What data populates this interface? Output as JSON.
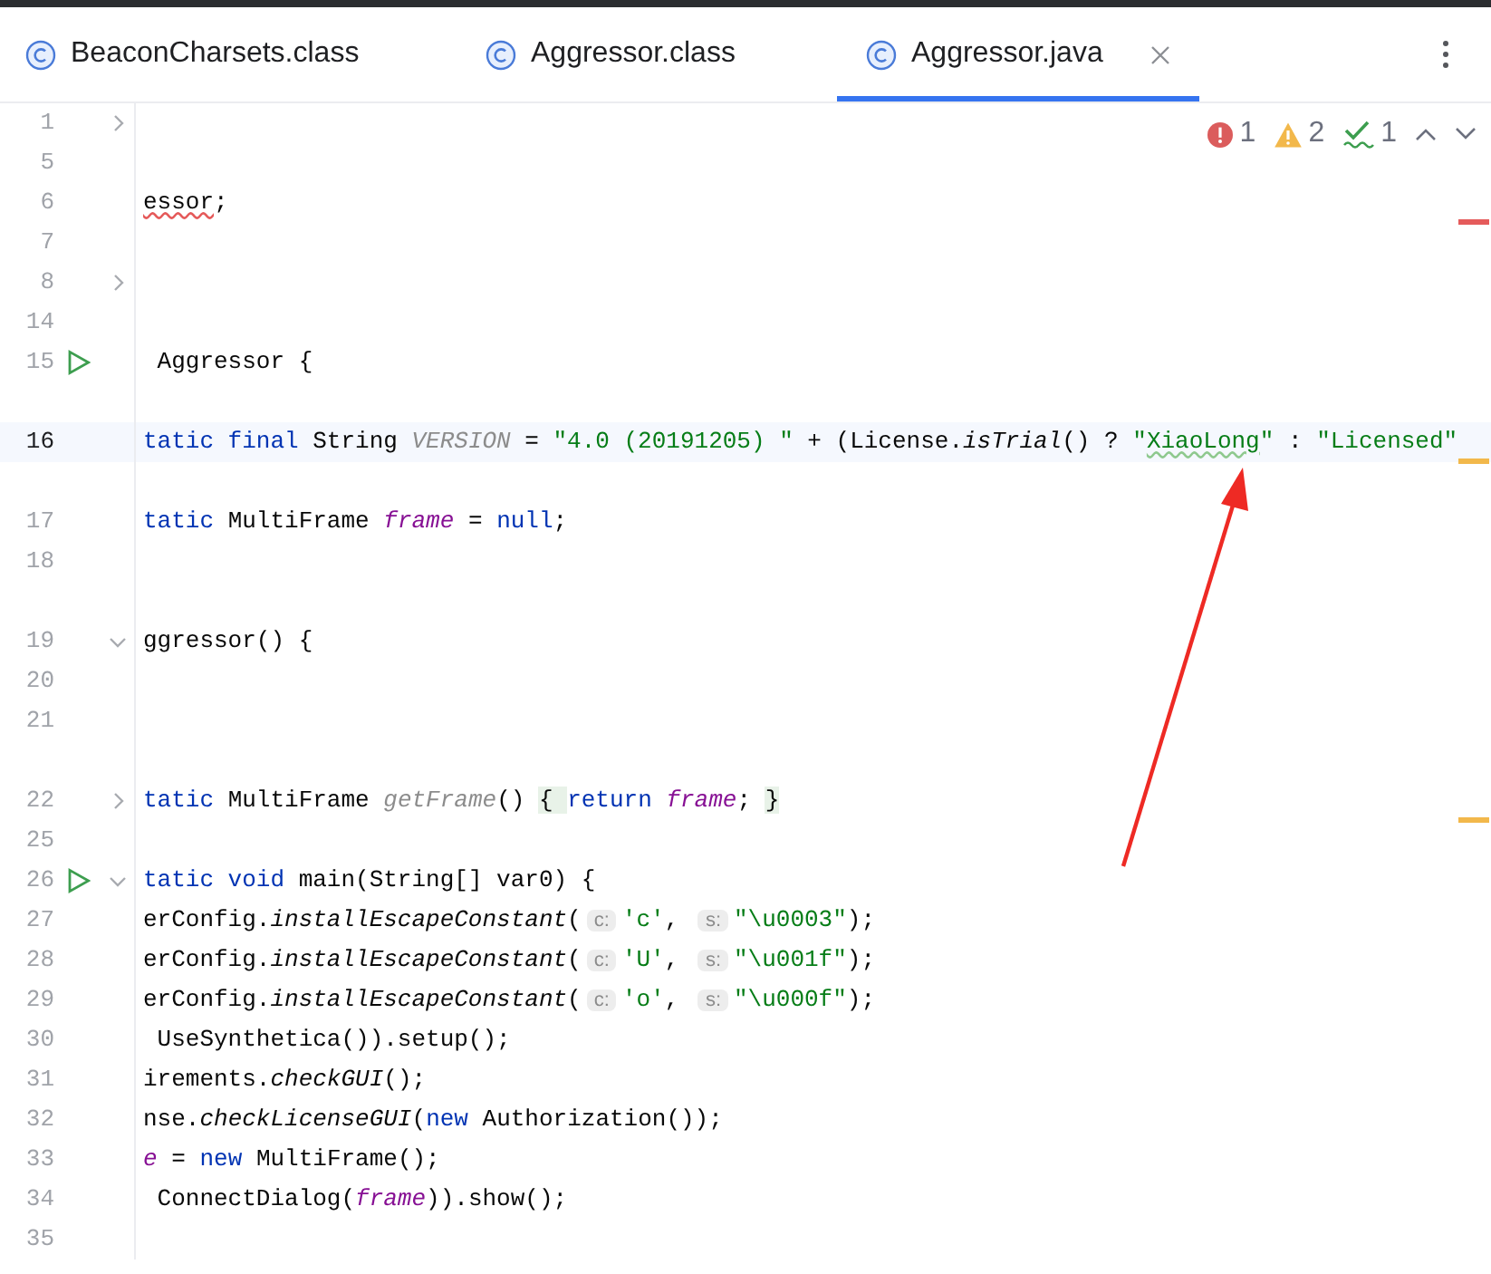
{
  "tabs": [
    {
      "label": "BeaconCharsets.class",
      "selected": false,
      "closable": false
    },
    {
      "label": "Aggressor.class",
      "selected": false,
      "closable": false
    },
    {
      "label": "Aggressor.java",
      "selected": true,
      "closable": true
    }
  ],
  "inspections": [
    {
      "kind": "error",
      "count": "1"
    },
    {
      "kind": "warning",
      "count": "2"
    },
    {
      "kind": "typo",
      "count": "1"
    }
  ],
  "lines": [
    {
      "kind": "line",
      "number": "1",
      "run": false,
      "fold": {
        "expanded": false
      },
      "current": false
    },
    {
      "kind": "line",
      "number": "5",
      "run": false,
      "current": false
    },
    {
      "kind": "line",
      "number": "6",
      "run": false,
      "current": false,
      "tokens": [
        {
          "kind": "error",
          "text": "essor"
        },
        {
          "kind": "plain",
          "text": ";"
        }
      ]
    },
    {
      "kind": "line",
      "number": "7",
      "run": false,
      "current": false,
      "marker": {
        "color": "#e55b5b"
      }
    },
    {
      "kind": "line",
      "number": "8",
      "run": false,
      "fold": {
        "expanded": false
      },
      "current": false
    },
    {
      "kind": "line",
      "number": "14",
      "run": false,
      "current": false
    },
    {
      "kind": "line",
      "number": "15",
      "run": true,
      "current": false,
      "tokens": [
        {
          "kind": "plain",
          "text": " Aggressor {"
        }
      ]
    },
    {
      "kind": "gap"
    },
    {
      "kind": "line",
      "number": "16",
      "run": false,
      "current": true,
      "tokens": [
        {
          "kind": "keyword",
          "text": "tatic final "
        },
        {
          "kind": "plain",
          "text": "String "
        },
        {
          "kind": "unused",
          "text": "VERSION"
        },
        {
          "kind": "plain",
          "text": " = "
        },
        {
          "kind": "string",
          "text": "\"4.0 (20191205) \""
        },
        {
          "kind": "plain",
          "text": " + (License."
        },
        {
          "kind": "italic",
          "text": "isTrial"
        },
        {
          "kind": "plain",
          "text": "() ? "
        },
        {
          "kind": "string",
          "text": "\""
        },
        {
          "kind": "typo",
          "text": "XiaoLong"
        },
        {
          "kind": "string",
          "text": "\""
        },
        {
          "kind": "plain",
          "text": " : "
        },
        {
          "kind": "string",
          "text": "\"Licensed\""
        }
      ]
    },
    {
      "kind": "gap",
      "marker": {
        "color": "#f2b84b"
      }
    },
    {
      "kind": "line",
      "number": "17",
      "run": false,
      "current": false,
      "tokens": [
        {
          "kind": "keyword",
          "text": "tatic "
        },
        {
          "kind": "plain",
          "text": "MultiFrame "
        },
        {
          "kind": "field",
          "text": "frame"
        },
        {
          "kind": "plain",
          "text": " = "
        },
        {
          "kind": "keyword",
          "text": "null"
        },
        {
          "kind": "plain",
          "text": ";"
        }
      ]
    },
    {
      "kind": "line",
      "number": "18",
      "run": false,
      "current": false
    },
    {
      "kind": "gap"
    },
    {
      "kind": "line",
      "number": "19",
      "run": false,
      "fold": {
        "expanded": true
      },
      "current": false,
      "tokens": [
        {
          "kind": "plain",
          "text": "ggressor() {"
        }
      ]
    },
    {
      "kind": "line",
      "number": "20",
      "run": false,
      "current": false
    },
    {
      "kind": "line",
      "number": "21",
      "run": false,
      "current": false
    },
    {
      "kind": "gap"
    },
    {
      "kind": "line",
      "number": "22",
      "run": false,
      "fold": {
        "expanded": false
      },
      "current": false,
      "tokens": [
        {
          "kind": "keyword",
          "text": "tatic "
        },
        {
          "kind": "plain",
          "text": "MultiFrame "
        },
        {
          "kind": "unused",
          "text": "getFrame"
        },
        {
          "kind": "plain",
          "text": "() "
        },
        {
          "kind": "folded",
          "text": "{ "
        },
        {
          "kind": "keyword",
          "text": "return "
        },
        {
          "kind": "field",
          "text": "frame"
        },
        {
          "kind": "plain",
          "text": "; "
        },
        {
          "kind": "folded",
          "text": "}"
        }
      ]
    },
    {
      "kind": "line",
      "number": "25",
      "run": false,
      "current": false,
      "marker": {
        "color": "#f2b84b"
      }
    },
    {
      "kind": "line",
      "number": "26",
      "run": true,
      "fold": {
        "expanded": true
      },
      "current": false,
      "tokens": [
        {
          "kind": "keyword",
          "text": "tatic void "
        },
        {
          "kind": "plain",
          "text": "main(String[] var0) {"
        }
      ]
    },
    {
      "kind": "line",
      "number": "27",
      "run": false,
      "current": false,
      "tokens": [
        {
          "kind": "plain",
          "text": "erConfig."
        },
        {
          "kind": "italic",
          "text": "installEscapeConstant"
        },
        {
          "kind": "plain",
          "text": "("
        },
        {
          "kind": "hint",
          "text": "c:"
        },
        {
          "kind": "string",
          "text": "'c'"
        },
        {
          "kind": "plain",
          "text": ", "
        },
        {
          "kind": "hint",
          "text": "s:"
        },
        {
          "kind": "string",
          "text": "\"\\u0003\""
        },
        {
          "kind": "plain",
          "text": ");"
        }
      ]
    },
    {
      "kind": "line",
      "number": "28",
      "run": false,
      "current": false,
      "tokens": [
        {
          "kind": "plain",
          "text": "erConfig."
        },
        {
          "kind": "italic",
          "text": "installEscapeConstant"
        },
        {
          "kind": "plain",
          "text": "("
        },
        {
          "kind": "hint",
          "text": "c:"
        },
        {
          "kind": "string",
          "text": "'U'"
        },
        {
          "kind": "plain",
          "text": ", "
        },
        {
          "kind": "hint",
          "text": "s:"
        },
        {
          "kind": "string",
          "text": "\"\\u001f\""
        },
        {
          "kind": "plain",
          "text": ");"
        }
      ]
    },
    {
      "kind": "line",
      "number": "29",
      "run": false,
      "current": false,
      "tokens": [
        {
          "kind": "plain",
          "text": "erConfig."
        },
        {
          "kind": "italic",
          "text": "installEscapeConstant"
        },
        {
          "kind": "plain",
          "text": "("
        },
        {
          "kind": "hint",
          "text": "c:"
        },
        {
          "kind": "string",
          "text": "'o'"
        },
        {
          "kind": "plain",
          "text": ", "
        },
        {
          "kind": "hint",
          "text": "s:"
        },
        {
          "kind": "string",
          "text": "\"\\u000f\""
        },
        {
          "kind": "plain",
          "text": ");"
        }
      ]
    },
    {
      "kind": "line",
      "number": "30",
      "run": false,
      "current": false,
      "tokens": [
        {
          "kind": "plain",
          "text": " UseSynthetica()).setup();"
        }
      ]
    },
    {
      "kind": "line",
      "number": "31",
      "run": false,
      "current": false,
      "tokens": [
        {
          "kind": "plain",
          "text": "irements."
        },
        {
          "kind": "italic",
          "text": "checkGUI"
        },
        {
          "kind": "plain",
          "text": "();"
        }
      ]
    },
    {
      "kind": "line",
      "number": "32",
      "run": false,
      "current": false,
      "tokens": [
        {
          "kind": "plain",
          "text": "nse."
        },
        {
          "kind": "italic",
          "text": "checkLicenseGUI"
        },
        {
          "kind": "plain",
          "text": "("
        },
        {
          "kind": "keyword",
          "text": "new "
        },
        {
          "kind": "plain",
          "text": "Authorization());"
        }
      ]
    },
    {
      "kind": "line",
      "number": "33",
      "run": false,
      "current": false,
      "tokens": [
        {
          "kind": "field",
          "text": "e"
        },
        {
          "kind": "plain",
          "text": " = "
        },
        {
          "kind": "keyword",
          "text": "new "
        },
        {
          "kind": "plain",
          "text": "MultiFrame();"
        }
      ]
    },
    {
      "kind": "line",
      "number": "34",
      "run": false,
      "current": false,
      "tokens": [
        {
          "kind": "plain",
          "text": " ConnectDialog("
        },
        {
          "kind": "field",
          "text": "frame"
        },
        {
          "kind": "plain",
          "text": ")).show();"
        }
      ]
    },
    {
      "kind": "line",
      "number": "35",
      "run": false,
      "current": false
    }
  ]
}
